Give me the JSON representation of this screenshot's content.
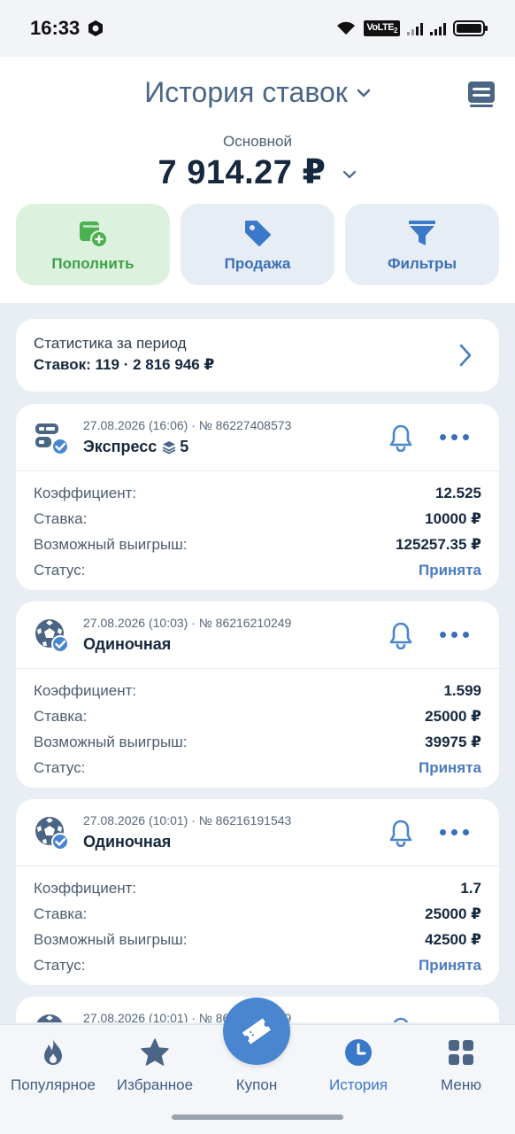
{
  "status_bar": {
    "time": "16:33",
    "volte": "VoLTE",
    "volte_sub": "2"
  },
  "header": {
    "title": "История ставок",
    "balance_label": "Основной",
    "balance": "7 914.27 ₽"
  },
  "actions": [
    {
      "label": "Пополнить",
      "icon": "wallet-plus-icon"
    },
    {
      "label": "Продажа",
      "icon": "tag-icon"
    },
    {
      "label": "Фильтры",
      "icon": "funnel-icon"
    }
  ],
  "stats": {
    "line1": "Статистика за период",
    "line2": "Ставок: 119 · 2 816 946 ₽"
  },
  "labels": {
    "coef": "Коэффициент:",
    "stake": "Ставка:",
    "payout": "Возможный выигрыш:",
    "status": "Статус:"
  },
  "bets": [
    {
      "meta": "27.08.2026 (16:06) · № 86227408573",
      "type": "Экспресс",
      "count": "5",
      "coef": "12.525",
      "stake": "10000 ₽",
      "payout": "125257.35 ₽",
      "status": "Принята"
    },
    {
      "meta": "27.08.2026 (10:03) · № 86216210249",
      "type": "Одиночная",
      "coef": "1.599",
      "stake": "25000 ₽",
      "payout": "39975 ₽",
      "status": "Принята"
    },
    {
      "meta": "27.08.2026 (10:01) · № 86216191543",
      "type": "Одиночная",
      "coef": "1.7",
      "stake": "25000 ₽",
      "payout": "42500 ₽",
      "status": "Принята"
    },
    {
      "meta": "27.08.2026 (10:01) · № 86216191399"
    }
  ],
  "nav": [
    {
      "label": "Популярное",
      "icon": "fire-icon"
    },
    {
      "label": "Избранное",
      "icon": "star-icon"
    },
    {
      "label": "Купон",
      "icon": "ticket-icon"
    },
    {
      "label": "История",
      "icon": "clock-icon"
    },
    {
      "label": "Меню",
      "icon": "grid-icon"
    }
  ],
  "colors": {
    "accent": "#3a78c9",
    "green": "#3aa147",
    "title": "#4a6585"
  }
}
